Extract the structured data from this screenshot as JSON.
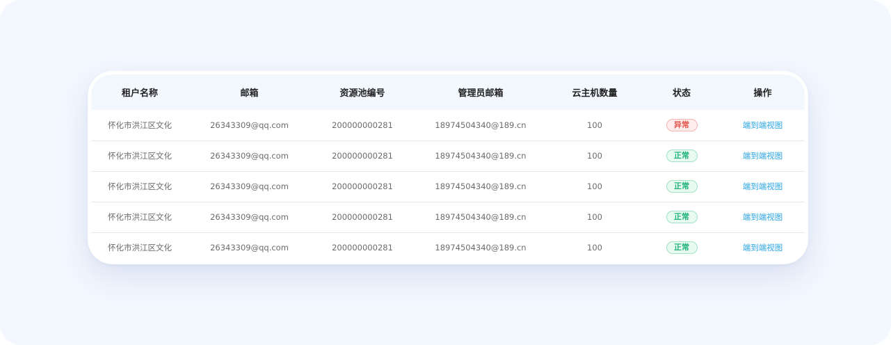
{
  "table": {
    "headers": [
      "租户名称",
      "邮箱",
      "资源池编号",
      "管理员邮箱",
      "云主机数量",
      "状态",
      "操作"
    ],
    "rows": [
      {
        "tenant": "怀化市洪江区文化",
        "email": "26343309@qq.com",
        "pool_id": "200000000281",
        "admin_email": "18974504340@189.cn",
        "vm_count": "100",
        "status": "异常",
        "status_type": "error",
        "action": "端到端视图"
      },
      {
        "tenant": "怀化市洪江区文化",
        "email": "26343309@qq.com",
        "pool_id": "200000000281",
        "admin_email": "18974504340@189.cn",
        "vm_count": "100",
        "status": "正常",
        "status_type": "ok",
        "action": "端到端视图"
      },
      {
        "tenant": "怀化市洪江区文化",
        "email": "26343309@qq.com",
        "pool_id": "200000000281",
        "admin_email": "18974504340@189.cn",
        "vm_count": "100",
        "status": "正常",
        "status_type": "ok",
        "action": "端到端视图"
      },
      {
        "tenant": "怀化市洪江区文化",
        "email": "26343309@qq.com",
        "pool_id": "200000000281",
        "admin_email": "18974504340@189.cn",
        "vm_count": "100",
        "status": "正常",
        "status_type": "ok",
        "action": "端到端视图"
      },
      {
        "tenant": "怀化市洪江区文化",
        "email": "26343309@qq.com",
        "pool_id": "200000000281",
        "admin_email": "18974504340@189.cn",
        "vm_count": "100",
        "status": "正常",
        "status_type": "ok",
        "action": "端到端视图"
      }
    ]
  },
  "colors": {
    "background": "#f3f7fe",
    "header_bg": "#f3f7fe",
    "status_ok": "#21b47a",
    "status_error": "#e2584f",
    "link": "#2aa4e0"
  }
}
